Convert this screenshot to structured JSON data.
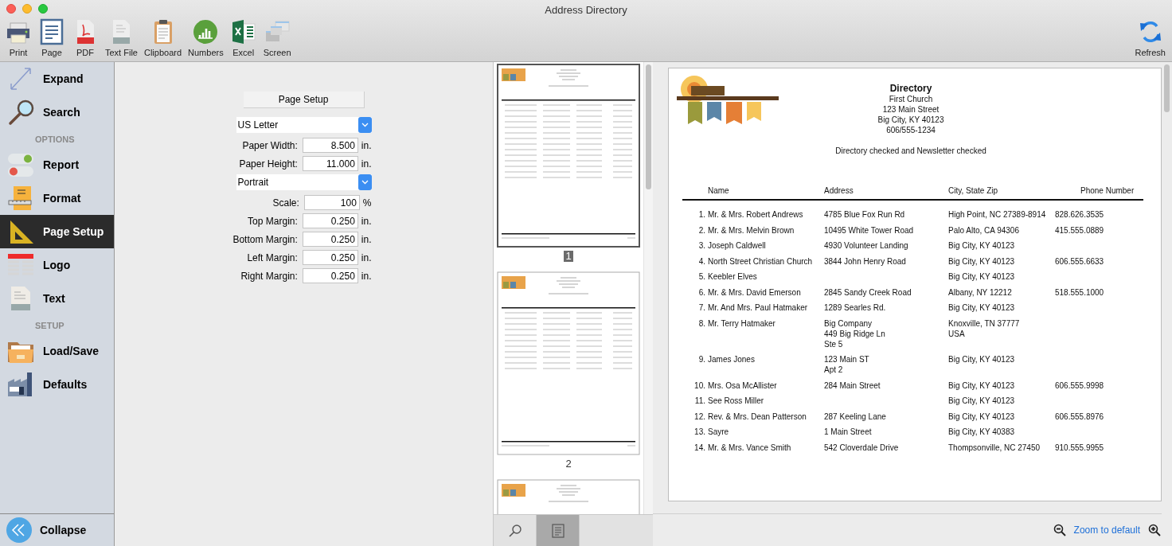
{
  "window": {
    "title": "Address Directory"
  },
  "toolbar": {
    "items": [
      {
        "label": "Print"
      },
      {
        "label": "Page"
      },
      {
        "label": "PDF"
      },
      {
        "label": "Text File"
      },
      {
        "label": "Clipboard"
      },
      {
        "label": "Numbers"
      },
      {
        "label": "Excel"
      },
      {
        "label": "Screen"
      }
    ],
    "refresh": "Refresh"
  },
  "sidebar": {
    "top_items": [
      {
        "label": "Expand",
        "selected": false
      },
      {
        "label": "Search",
        "selected": false
      }
    ],
    "sections": [
      {
        "title": "OPTIONS",
        "items": [
          {
            "label": "Report",
            "selected": false
          },
          {
            "label": "Format",
            "selected": false
          },
          {
            "label": "Page Setup",
            "selected": true
          },
          {
            "label": "Logo",
            "selected": false
          },
          {
            "label": "Text",
            "selected": false
          }
        ]
      },
      {
        "title": "SETUP",
        "items": [
          {
            "label": "Load/Save",
            "selected": false
          },
          {
            "label": "Defaults",
            "selected": false
          }
        ]
      }
    ],
    "collapse": "Collapse"
  },
  "page_setup": {
    "button": "Page Setup",
    "controls": [
      {
        "kind": "select",
        "value": "US Letter"
      },
      {
        "kind": "field",
        "label": "Paper Width:",
        "value": "8.500",
        "unit": "in."
      },
      {
        "kind": "field",
        "label": "Paper Height:",
        "value": "11.000",
        "unit": "in."
      },
      {
        "kind": "select",
        "value": "Portrait"
      },
      {
        "kind": "field",
        "label": "Scale:",
        "value": "100",
        "unit": "%"
      },
      {
        "kind": "field",
        "label": "Top Margin:",
        "value": "0.250",
        "unit": "in."
      },
      {
        "kind": "field",
        "label": "Bottom Margin:",
        "value": "0.250",
        "unit": "in."
      },
      {
        "kind": "field",
        "label": "Left Margin:",
        "value": "0.250",
        "unit": "in."
      },
      {
        "kind": "field",
        "label": "Right Margin:",
        "value": "0.250",
        "unit": "in."
      }
    ]
  },
  "thumbnails": [
    {
      "page_label": "1",
      "selected": true
    },
    {
      "page_label": "2",
      "selected": false
    },
    {
      "selected": false
    }
  ],
  "thumbnail_tabs": [
    {
      "kind": "search",
      "selected": false
    },
    {
      "kind": "page",
      "selected": true
    }
  ],
  "zoom": {
    "label": "Zoom to default"
  },
  "preview": {
    "title": "Directory",
    "header_lines": [
      "First Church",
      "123 Main Street",
      "Big City, KY  40123",
      "606/555-1234"
    ],
    "subtitle": "Directory checked and Newsletter checked",
    "columns": [
      "Name",
      "Address",
      "City, State  Zip",
      "Phone Number"
    ],
    "rows": [
      {
        "number": "1.",
        "name": "Mr. & Mrs. Robert Andrews",
        "address": [
          "4785 Blue Fox Run Rd"
        ],
        "city": [
          "High Point, NC 27389-8914"
        ],
        "phone": "828.626.3535"
      },
      {
        "number": "2.",
        "name": "Mr. & Mrs. Melvin Brown",
        "address": [
          "10495 White Tower Road"
        ],
        "city": [
          "Palo Alto, CA 94306"
        ],
        "phone": "415.555.0889"
      },
      {
        "number": "3.",
        "name": "Joseph Caldwell",
        "address": [
          "4930 Volunteer Landing"
        ],
        "city": [
          "Big City, KY 40123"
        ]
      },
      {
        "number": "4.",
        "name": "North Street Christian Church",
        "address": [
          "3844 John Henry Road"
        ],
        "city": [
          "Big City, KY 40123"
        ],
        "phone": "606.555.6633"
      },
      {
        "number": "5.",
        "name": "Keebler Elves",
        "city": [
          "Big City, KY 40123"
        ]
      },
      {
        "number": "6.",
        "name": "Mr. & Mrs. David Emerson",
        "address": [
          "2845 Sandy Creek Road"
        ],
        "city": [
          "Albany, NY 12212"
        ],
        "phone": "518.555.1000"
      },
      {
        "number": "7.",
        "name": "Mr. And Mrs. Paul Hatmaker",
        "address": [
          "1289 Searles Rd."
        ],
        "city": [
          "Big City, KY 40123"
        ]
      },
      {
        "number": "8.",
        "name": "Mr. Terry Hatmaker",
        "address": [
          "Big Company",
          "449 Big Ridge Ln",
          "Ste 5"
        ],
        "city": [
          "Knoxville, TN 37777",
          "USA"
        ]
      },
      {
        "number": "9.",
        "name": "James Jones",
        "address": [
          "123 Main ST",
          "Apt 2"
        ],
        "city": [
          "Big City, KY 40123"
        ]
      },
      {
        "number": "10.",
        "name": "Mrs. Osa McAllister",
        "address": [
          "284 Main Street"
        ],
        "city": [
          "Big City, KY 40123"
        ],
        "phone": "606.555.9998"
      },
      {
        "number": "11.",
        "name": "See Ross Miller",
        "city": [
          "Big City, KY 40123"
        ]
      },
      {
        "number": "12.",
        "name": "Rev. & Mrs. Dean Patterson",
        "address": [
          "287 Keeling Lane"
        ],
        "city": [
          "Big City, KY 40123"
        ],
        "phone": "606.555.8976"
      },
      {
        "number": "13.",
        "name": "Sayre",
        "address": [
          "1 Main Street"
        ],
        "city": [
          "Big City, KY 40383"
        ]
      },
      {
        "number": "14.",
        "name": "Mr. & Mrs. Vance Smith",
        "address": [
          "542 Cloverdale Drive"
        ],
        "city": [
          "Thompsonville, NC 27450"
        ],
        "phone": "910.555.9955"
      }
    ]
  }
}
